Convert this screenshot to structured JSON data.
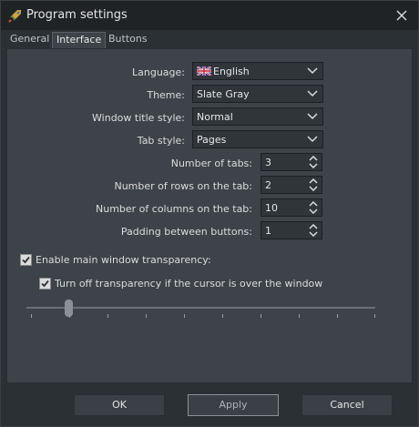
{
  "window": {
    "title": "Program settings"
  },
  "tabs": [
    {
      "label": "General",
      "active": false
    },
    {
      "label": "Interface",
      "active": true
    },
    {
      "label": "Buttons",
      "active": false
    }
  ],
  "form": {
    "language": {
      "label": "Language:",
      "value": "English"
    },
    "theme": {
      "label": "Theme:",
      "value": "Slate Gray"
    },
    "window_title_style": {
      "label": "Window title style:",
      "value": "Normal"
    },
    "tab_style": {
      "label": "Tab style:",
      "value": "Pages"
    },
    "number_of_tabs": {
      "label": "Number of tabs:",
      "value": "3"
    },
    "rows_on_tab": {
      "label": "Number of rows on the tab:",
      "value": "2"
    },
    "columns_on_tab": {
      "label": "Number of columns on the tab:",
      "value": "10"
    },
    "padding_between_buttons": {
      "label": "Padding between buttons:",
      "value": "1"
    }
  },
  "transparency": {
    "enable_label": "Enable main window transparency:",
    "enable_checked": true,
    "cursor_off_label": "Turn off transparency if the cursor is over the window",
    "cursor_off_checked": true,
    "slider_level": 0.11,
    "tick_count": 10
  },
  "buttons": {
    "ok": "OK",
    "apply": "Apply",
    "cancel": "Cancel"
  },
  "colors": {
    "background": "#2b3035",
    "panel": "#3d4348",
    "field": "#30353a",
    "check_mark": "#2b3035"
  }
}
